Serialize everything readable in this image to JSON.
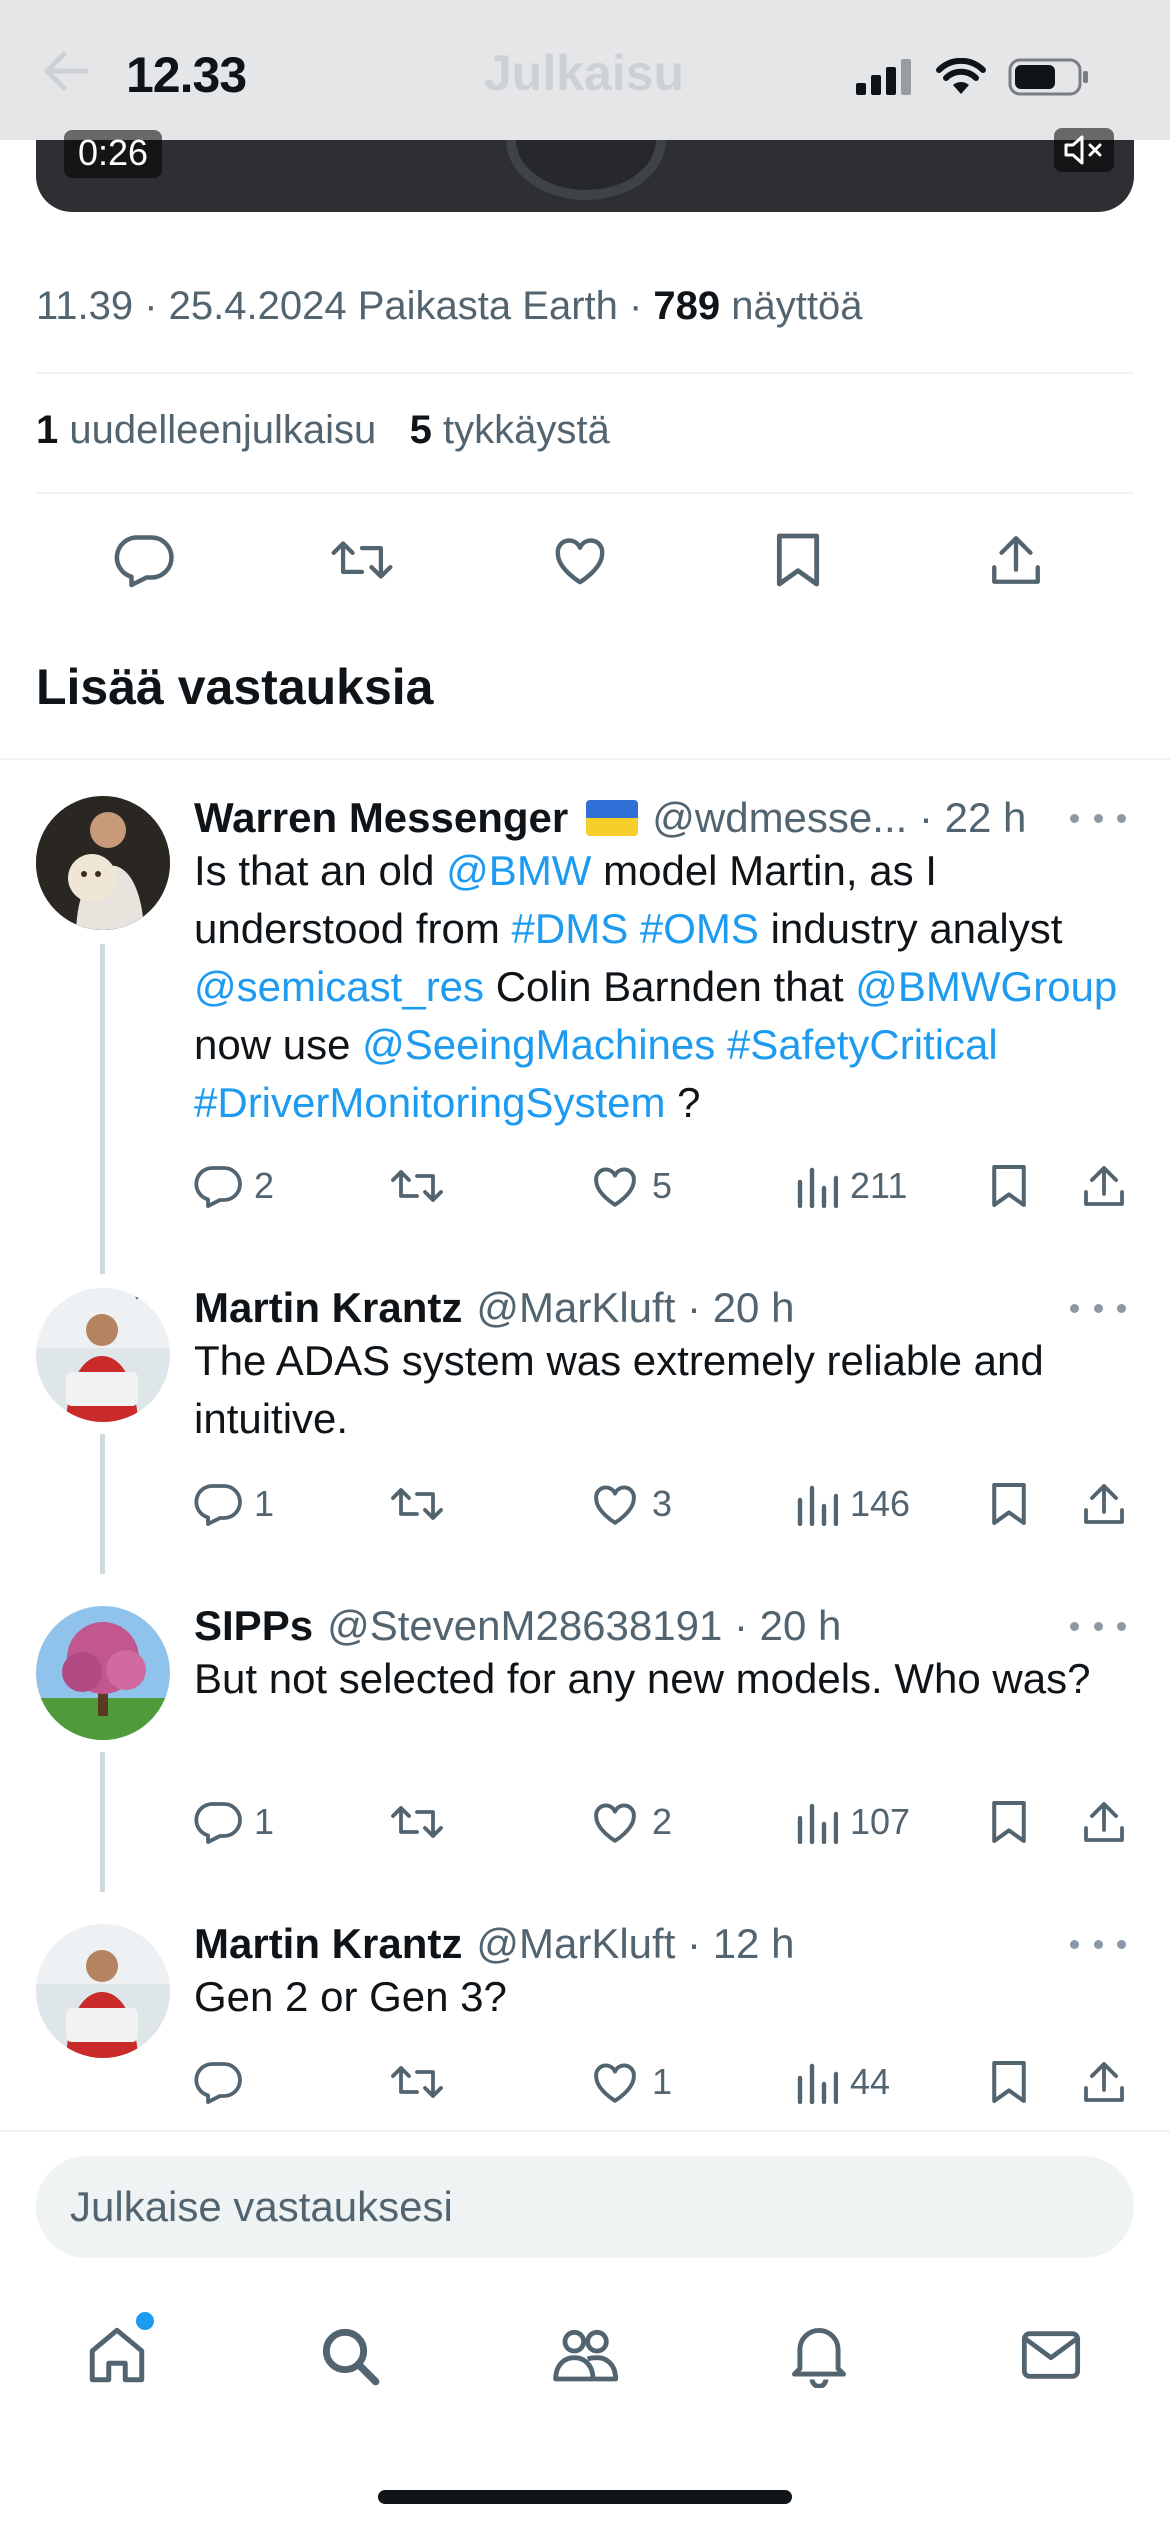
{
  "status_bar": {
    "time": "12.33",
    "header_title": "Julkaisu"
  },
  "video": {
    "time": "0:26"
  },
  "post": {
    "timestamp_location": "11.39 · 25.4.2024 Paikasta Earth · ",
    "views_count": "789",
    "views_label": " näyttöä",
    "reposts_count": "1",
    "reposts_label": " uudelleenjulkaisu",
    "likes_count": "5",
    "likes_label": " tykkäystä"
  },
  "section_title": "Lisää vastauksia",
  "replies": [
    {
      "name": "Warren Messenger",
      "handle": "@wdmesse... · 22 h",
      "text_parts": [
        "Is that an old ",
        "@BMW",
        " model Martin, as I understood from ",
        "#DMS",
        " ",
        "#OMS",
        " industry analyst ",
        "@semicast_res",
        " Colin Barnden that ",
        "@BMWGroup",
        " now use ",
        "@SeeingMachines",
        " ",
        "#SafetyCritical",
        " ",
        "#DriverMonitoringSystem",
        " ?"
      ],
      "replies": "2",
      "reposts": "",
      "likes": "5",
      "views": "211"
    },
    {
      "name": "Martin Krantz",
      "handle": "@MarKluft · 20 h",
      "text": "The ADAS system was extremely reliable and intuitive.",
      "replies": "1",
      "reposts": "",
      "likes": "3",
      "views": "146"
    },
    {
      "name": "SIPPs",
      "handle": "@StevenM28638191 · 20 h",
      "text": "But not selected for any new models. Who was?",
      "replies": "1",
      "reposts": "",
      "likes": "2",
      "views": "107"
    },
    {
      "name": "Martin Krantz",
      "handle": "@MarKluft · 12 h",
      "text": "Gen 2 or Gen 3?",
      "replies": "",
      "reposts": "",
      "likes": "1",
      "views": "44"
    }
  ],
  "compose": {
    "placeholder": "Julkaise vastauksesi"
  },
  "colors": {
    "accent": "#1d9bf0",
    "text": "#0f1419",
    "secondary": "#536471",
    "divider": "#eff3f4"
  },
  "icons": [
    "back-arrow-icon",
    "signal-icon",
    "wifi-icon",
    "battery-icon",
    "mute-icon",
    "reply-icon",
    "repost-icon",
    "like-icon",
    "bookmark-icon",
    "share-icon",
    "views-icon",
    "more-icon",
    "home-icon",
    "search-icon",
    "communities-icon",
    "notifications-icon",
    "messages-icon"
  ]
}
